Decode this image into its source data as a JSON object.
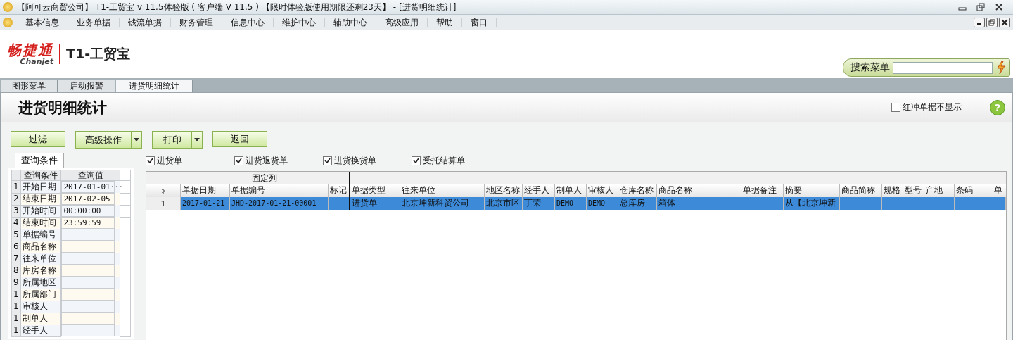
{
  "title_bar": {
    "title": "【阿可云商贸公司】 T1-工贸宝 v 11.5体验版 ( 客户端 V 11.5 ) 【限时体验版使用期限还剩23天】 - [进货明细统计]"
  },
  "menu": [
    "基本信息",
    "业务单据",
    "钱流单据",
    "财务管理",
    "信息中心",
    "维护中心",
    "辅助中心",
    "高级应用",
    "帮助",
    "窗口"
  ],
  "logo": {
    "brand": "畅捷通",
    "brand_en": "Chanjet",
    "product": "T1-工贸宝"
  },
  "search": {
    "label": "搜索菜单"
  },
  "tabs": [
    {
      "label": "图形菜单",
      "selected": false
    },
    {
      "label": "启动报警",
      "selected": false
    },
    {
      "label": "进货明细统计",
      "selected": true
    }
  ],
  "page": {
    "title": "进货明细统计",
    "help": "?",
    "hide_red": {
      "label": "红冲单据不显示",
      "checked": false
    }
  },
  "toolbar": [
    {
      "label": "过滤",
      "kind": "button"
    },
    {
      "label": "高级操作",
      "kind": "split"
    },
    {
      "label": "打印",
      "kind": "split"
    },
    {
      "label": "返回",
      "kind": "button"
    }
  ],
  "query_panel": {
    "tab": "查询条件",
    "columns": [
      "查询条件",
      "查询值"
    ],
    "rows": [
      {
        "num": "1",
        "name": "开始日期",
        "value": "2017-01-01",
        "picker": "···"
      },
      {
        "num": "2",
        "name": "结束日期",
        "value": "2017-02-05"
      },
      {
        "num": "3",
        "name": "开始时间",
        "value": "00:00:00"
      },
      {
        "num": "4",
        "name": "结束时间",
        "value": "23:59:59"
      },
      {
        "num": "5",
        "name": "单据编号"
      },
      {
        "num": "6",
        "name": "商品名称"
      },
      {
        "num": "7",
        "name": "往来单位"
      },
      {
        "num": "8",
        "name": "库房名称"
      },
      {
        "num": "9",
        "name": "所属地区"
      },
      {
        "num": "1",
        "name": "所属部门"
      },
      {
        "num": "1",
        "name": "审核人"
      },
      {
        "num": "1",
        "name": "制单人"
      },
      {
        "num": "1",
        "name": "经手人"
      }
    ]
  },
  "filters": [
    {
      "label": "进货单",
      "checked": true
    },
    {
      "label": "进货退货单",
      "checked": true
    },
    {
      "label": "进货换货单",
      "checked": true
    },
    {
      "label": "受托结算单",
      "checked": true
    }
  ],
  "grid": {
    "fixed_label": "固定列",
    "columns": [
      "单据日期",
      "单据编号",
      "标记",
      "单据类型",
      "往来单位",
      "地区名称",
      "经手人",
      "制单人",
      "审核人",
      "仓库名称",
      "商品名称",
      "单据备注",
      "摘要",
      "商品简称",
      "规格",
      "型号",
      "产地",
      "条码",
      "单"
    ],
    "rows": [
      {
        "num": "1",
        "selected": true,
        "cells": [
          "2017-01-21",
          "JHD-2017-01-21-00001",
          "",
          "进货单",
          "北京坤新科贸公司",
          "北京市区",
          "丁荣",
          "DEMO",
          "DEMO",
          "总库房",
          "箱体",
          "",
          "从【北京坤新",
          "",
          "",
          "",
          "",
          "",
          ""
        ]
      }
    ]
  }
}
